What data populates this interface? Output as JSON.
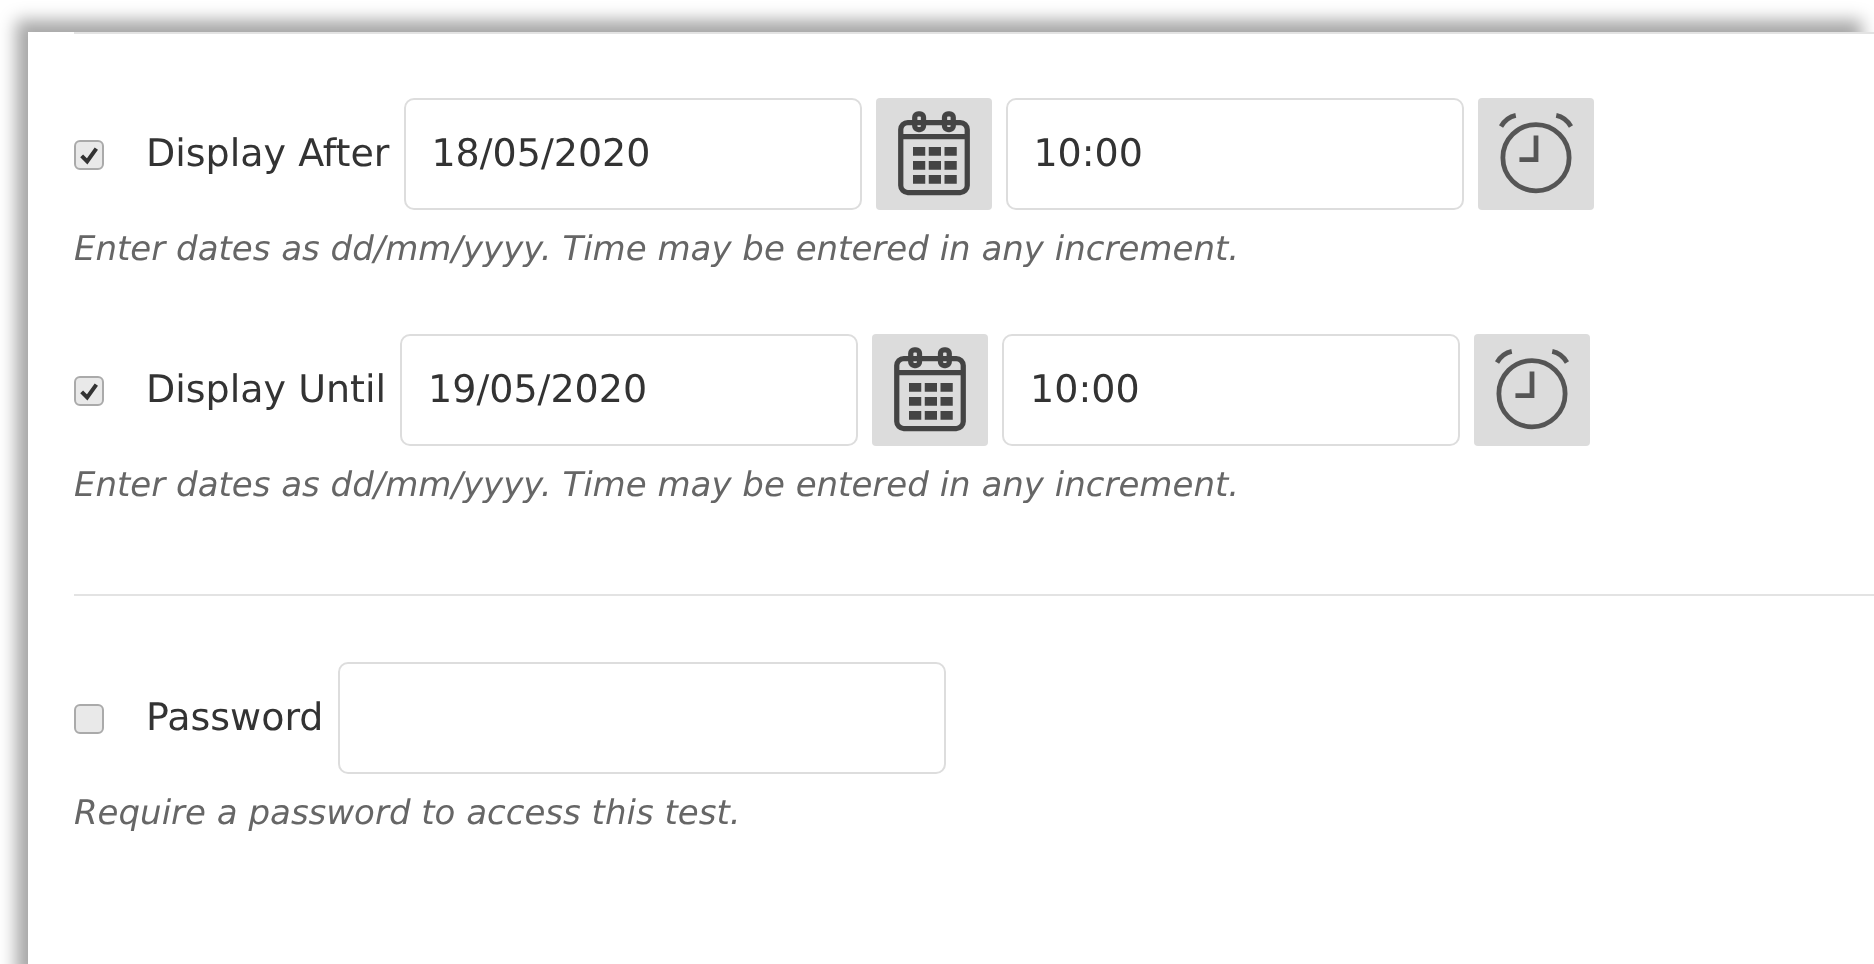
{
  "rows": [
    {
      "kind": "datetime",
      "label": "Display After",
      "checked": true,
      "date": "18/05/2020",
      "time": "10:00",
      "hint": "Enter dates as dd/mm/yyyy. Time may be entered in any increment."
    },
    {
      "kind": "datetime",
      "label": "Display Until",
      "checked": true,
      "date": "19/05/2020",
      "time": "10:00",
      "hint": "Enter dates as dd/mm/yyyy. Time may be entered in any increment."
    },
    {
      "kind": "password",
      "label": "Password",
      "checked": false,
      "hint": "Require a password to access this test."
    }
  ]
}
